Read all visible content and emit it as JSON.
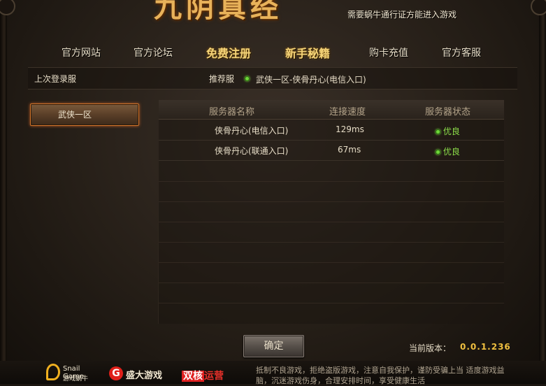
{
  "header": {
    "logo_text": "九阴真经",
    "notice": "需要蜗牛通行证方能进入游戏"
  },
  "nav": {
    "items": [
      {
        "label": "官方网站",
        "highlight": false
      },
      {
        "label": "官方论坛",
        "highlight": false
      },
      {
        "label": "免费注册",
        "highlight": true
      },
      {
        "label": "新手秘籍",
        "highlight": true
      },
      {
        "label": "购卡充值",
        "highlight": false
      },
      {
        "label": "官方客服",
        "highlight": false
      }
    ]
  },
  "infobar": {
    "last_server_label": "上次登录服",
    "recommend_label": "推荐服",
    "recommend_server": "武侠一区-侠骨丹心(电信入口)"
  },
  "regions": [
    {
      "label": "武侠一区",
      "selected": true
    }
  ],
  "server_table": {
    "columns": [
      "服务器名称",
      "连接速度",
      "服务器状态"
    ],
    "rows": [
      {
        "name": "侠骨丹心(电信入口)",
        "speed": "129ms",
        "status": "优良",
        "status_color": "#8de04a"
      },
      {
        "name": "侠骨丹心(联通入口)",
        "speed": "67ms",
        "status": "优良",
        "status_color": "#8de04a"
      }
    ]
  },
  "footer": {
    "confirm_label": "确定",
    "version_label": "当前版本：",
    "version_value": "0.0.1.236",
    "snail_en": "Snail Game",
    "snail_cn": "游戏蜗牛",
    "shanda_mark": "G",
    "shanda_text": "盛大游戏",
    "dualcore_a": "双核",
    "dualcore_b": "运营",
    "health_notice": "抵制不良游戏，拒绝盗版游戏，注意自我保护，谨防受骗上当 适度游戏益脑，沉迷游戏伤身，合理安排时间，享受健康生活"
  },
  "colors": {
    "accent_gold": "#f5d478",
    "status_good": "#8de04a",
    "selected_border": "#d0742a",
    "version_value": "#f0c040"
  }
}
